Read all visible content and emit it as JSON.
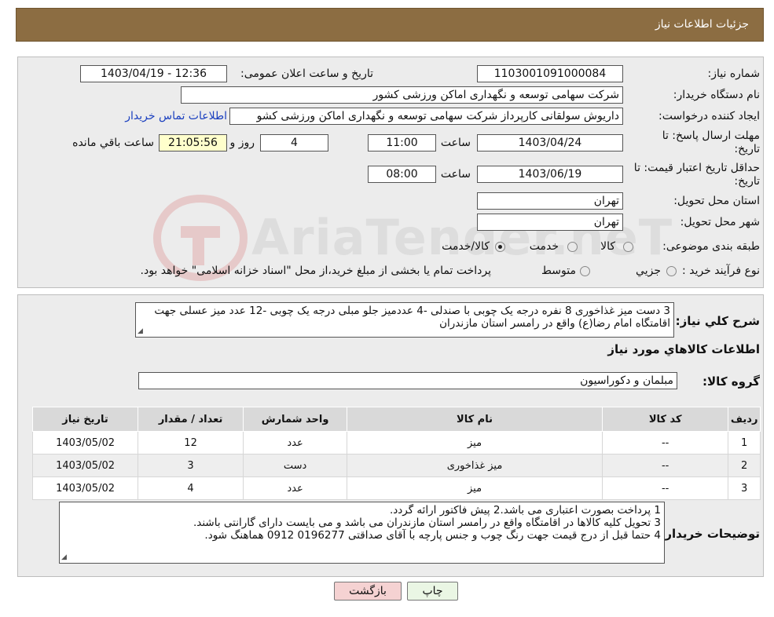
{
  "header": {
    "title": "جزئیات اطلاعات نیاز"
  },
  "form": {
    "need_number_label": "شماره نیاز:",
    "need_number": "1103001091000084",
    "announce_label": "تاریخ و ساعت اعلان عمومی:",
    "announce_value": "1403/04/19 - 12:36",
    "buyer_label": "نام دستگاه خریدار:",
    "buyer_value": "شرکت سهامی توسعه و نگهداری اماکن ورزشی کشور",
    "creator_label": "ایجاد کننده درخواست:",
    "creator_value": "داریوش سولقانی کارپرداز شرکت سهامی توسعه و نگهداری اماکن ورزشی کشو",
    "contact_link": "اطلاعات تماس خریدار",
    "deadline_label_1": "مهلت ارسال پاسخ: تا",
    "deadline_label_2": "تاریخ:",
    "deadline_date": "1403/04/24",
    "time_label": "ساعت",
    "deadline_time": "11:00",
    "days_value": "4",
    "days_label": "روز و",
    "remaining_time": "21:05:56",
    "remaining_label": "ساعت باقي مانده",
    "validity_label_1": "حداقل تاریخ اعتبار قیمت: تا",
    "validity_label_2": "تاریخ:",
    "validity_date": "1403/06/19",
    "validity_time_label": "ساعت",
    "validity_time": "08:00",
    "province_label": "استان محل تحویل:",
    "province_value": "تهران",
    "city_label": "شهر محل تحویل:",
    "city_value": "تهران",
    "category_label": "طبقه بندی موضوعی:",
    "category_options": [
      "کالا",
      "خدمت",
      "کالا/خدمت"
    ],
    "process_label": "نوع فرآیند خرید :",
    "process_options": [
      "جزیي",
      "متوسط"
    ],
    "process_note": "پرداخت تمام یا بخشی از مبلغ خرید،از محل \"اسناد خزانه اسلامی\" خواهد بود."
  },
  "description": {
    "label": "شرح کلي نياز:",
    "text": "3 دست میز غذاخوری 8 نفره درجه یک چوبی با صندلی -4 عددمیز جلو مبلی درجه یک چوبی -12 عدد میز عسلی جهت اقامتگاه امام رضا(ع) واقع در رامسر استان مازندران"
  },
  "goods": {
    "section_title": "اطلاعات کالاهاي مورد نياز",
    "group_label": "گروه کالا:",
    "group_value": "مبلمان و دکوراسیون",
    "columns": [
      "رديف",
      "کد کالا",
      "نام کالا",
      "واحد شمارش",
      "تعداد / مقدار",
      "تاریخ نیاز"
    ],
    "rows": [
      [
        "1",
        "--",
        "میز",
        "عدد",
        "12",
        "1403/05/02"
      ],
      [
        "2",
        "--",
        "میز غذاخوری",
        "دست",
        "3",
        "1403/05/02"
      ],
      [
        "3",
        "--",
        "میز",
        "عدد",
        "4",
        "1403/05/02"
      ]
    ]
  },
  "notes": {
    "label": "توضیحات خریدار:",
    "lines": [
      "1 پرداخت بصورت اعتباری می باشد.2 پیش فاکتور ارائه گردد.",
      "3 تحویل کلیه کالاها در اقامتگاه واقع در رامسر استان مازندران می باشد و می بایست دارای گارانتی باشند.",
      "4 حتما قبل از درج قیمت جهت رنگ چوب و جنس پارچه با  آقای صداقتی 0196277  0912 هماهنگ شود."
    ]
  },
  "buttons": {
    "print": "چاپ",
    "back": "بازگشت"
  },
  "watermark": {
    "text": "AriaTender.neT"
  },
  "colors": {
    "header": "#8c6d42",
    "link": "#1a3fbf",
    "print_btn": "#eaf6e4",
    "back_btn": "#f5d2d2"
  }
}
